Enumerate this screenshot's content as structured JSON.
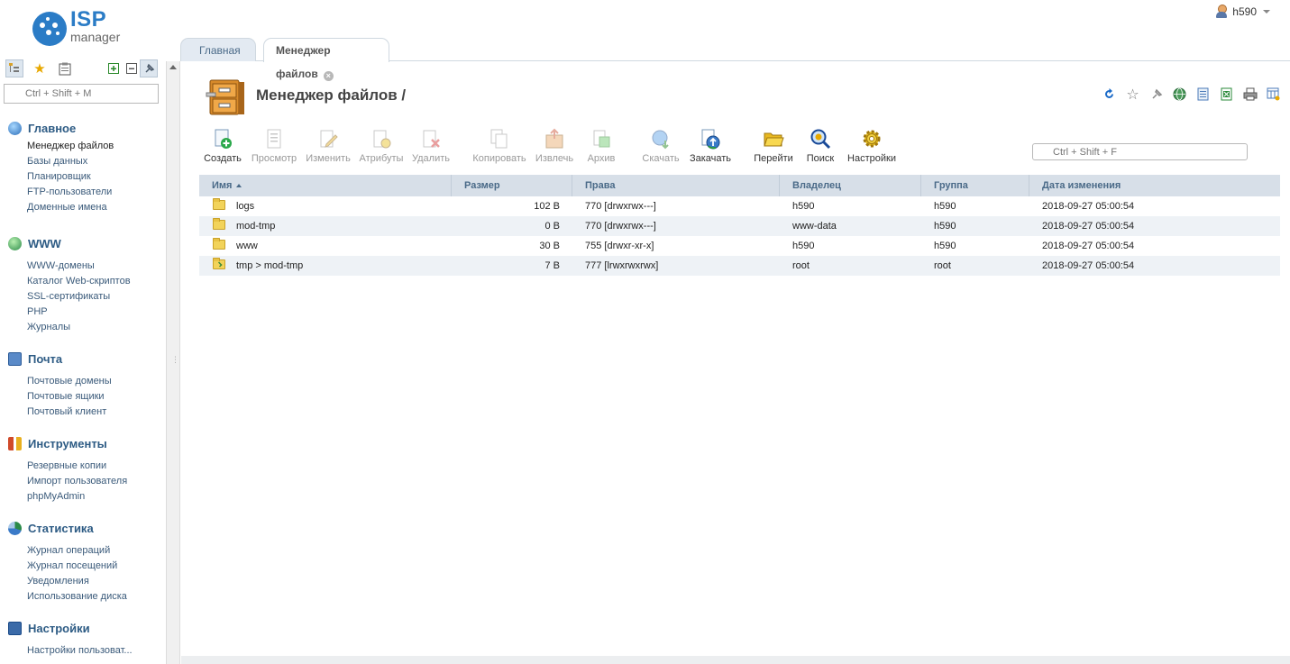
{
  "logo": {
    "word1": "ISP",
    "word2": "manager"
  },
  "user": {
    "name": "h590"
  },
  "tabs": [
    {
      "label": "Главная"
    },
    {
      "label": "Менеджер файлов",
      "close": "×"
    }
  ],
  "sidebar": {
    "search_placeholder": "Ctrl + Shift + M",
    "sections": [
      {
        "title": "Главное",
        "items": [
          "Менеджер файлов",
          "Базы данных",
          "Планировщик",
          "FTP-пользователи",
          "Доменные имена"
        ]
      },
      {
        "title": "WWW",
        "items": [
          "WWW-домены",
          "Каталог Web-скриптов",
          "SSL-сертификаты",
          "PHP",
          "Журналы"
        ]
      },
      {
        "title": "Почта",
        "items": [
          "Почтовые домены",
          "Почтовые ящики",
          "Почтовый клиент"
        ]
      },
      {
        "title": "Инструменты",
        "items": [
          "Резервные копии",
          "Импорт пользователя",
          "phpMyAdmin"
        ]
      },
      {
        "title": "Статистика",
        "items": [
          "Журнал операций",
          "Журнал посещений",
          "Уведомления",
          "Использование диска"
        ]
      },
      {
        "title": "Настройки",
        "items": [
          "Настройки пользоват..."
        ]
      }
    ]
  },
  "page": {
    "title": "Менеджер файлов /"
  },
  "toolbar": {
    "create": "Создать",
    "view": "Просмотр",
    "edit": "Изменить",
    "attributes": "Атрибуты",
    "delete": "Удалить",
    "copy": "Копировать",
    "extract": "Извлечь",
    "archive": "Архив",
    "download": "Скачать",
    "upload": "Закачать",
    "goto": "Перейти",
    "search": "Поиск",
    "settings": "Настройки",
    "filter_placeholder": "Ctrl + Shift + F"
  },
  "table": {
    "columns": [
      "Имя",
      "Размер",
      "Права",
      "Владелец",
      "Группа",
      "Дата изменения"
    ],
    "rows": [
      {
        "name": "logs",
        "size": "102 B",
        "perm": "770 [drwxrwx---]",
        "owner": "h590",
        "group": "h590",
        "date": "2018-09-27 05:00:54"
      },
      {
        "name": "mod-tmp",
        "size": "0 B",
        "perm": "770 [drwxrwx---]",
        "owner": "www-data",
        "group": "h590",
        "date": "2018-09-27 05:00:54"
      },
      {
        "name": "www",
        "size": "30 B",
        "perm": "755 [drwxr-xr-x]",
        "owner": "h590",
        "group": "h590",
        "date": "2018-09-27 05:00:54"
      },
      {
        "name": "tmp > mod-tmp",
        "size": "7 B",
        "perm": "777 [lrwxrwxrwx]",
        "owner": "root",
        "group": "root",
        "date": "2018-09-27 05:00:54"
      }
    ]
  },
  "colors": {
    "accent": "#2d5b84",
    "logo": "#2b7cc6",
    "header_bg": "#d7dfe8"
  }
}
